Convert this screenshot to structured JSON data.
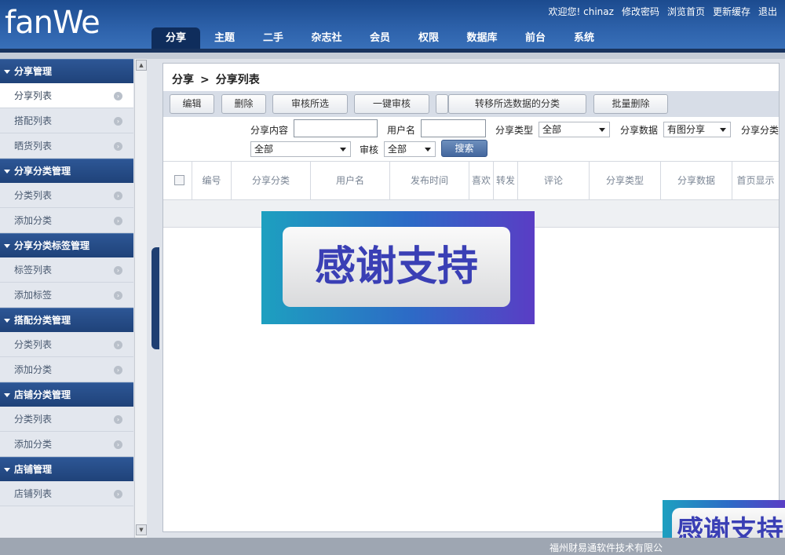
{
  "header": {
    "logo": "fanWe",
    "links": [
      "欢迎您! chinaz",
      "修改密码",
      "浏览首页",
      "更新缓存",
      "退出"
    ],
    "tabs": [
      "分享",
      "主题",
      "二手",
      "杂志社",
      "会员",
      "权限",
      "数据库",
      "前台",
      "系统"
    ]
  },
  "sidebar": {
    "groups": [
      {
        "title": "分享管理",
        "items": [
          "分享列表",
          "搭配列表",
          "晒货列表"
        ]
      },
      {
        "title": "分享分类管理",
        "items": [
          "分类列表",
          "添加分类"
        ]
      },
      {
        "title": "分享分类标签管理",
        "items": [
          "标签列表",
          "添加标签"
        ]
      },
      {
        "title": "搭配分类管理",
        "items": [
          "分类列表",
          "添加分类"
        ]
      },
      {
        "title": "店铺分类管理",
        "items": [
          "分类列表",
          "添加分类"
        ]
      },
      {
        "title": "店铺管理",
        "items": [
          "店铺列表"
        ]
      }
    ]
  },
  "breadcrumb": {
    "parent": "分享",
    "sep": ">",
    "current": "分享列表"
  },
  "toolbar": [
    "编辑",
    "删除",
    "审核所选",
    "一键审核",
    "转移所选数据的分类",
    "批量删除"
  ],
  "filters": {
    "content_label": "分享内容",
    "content_value": "",
    "user_label": "用户名",
    "user_value": "",
    "type_label": "分享类型",
    "type_value": "全部",
    "data_label": "分享数据",
    "data_value": "有图分享",
    "cat_label": "分享分类",
    "cat_value": "全部",
    "audit_label": "审核",
    "audit_value": "全部",
    "search_label": "搜索"
  },
  "table": {
    "columns": [
      "编号",
      "分享分类",
      "用户名",
      "发布时间",
      "喜欢",
      "转发",
      "评论",
      "分享类型",
      "分享数据",
      "首页显示"
    ]
  },
  "banner": {
    "text": "感谢支持"
  },
  "footer": {
    "text": "福州财易通软件技术有限公"
  }
}
